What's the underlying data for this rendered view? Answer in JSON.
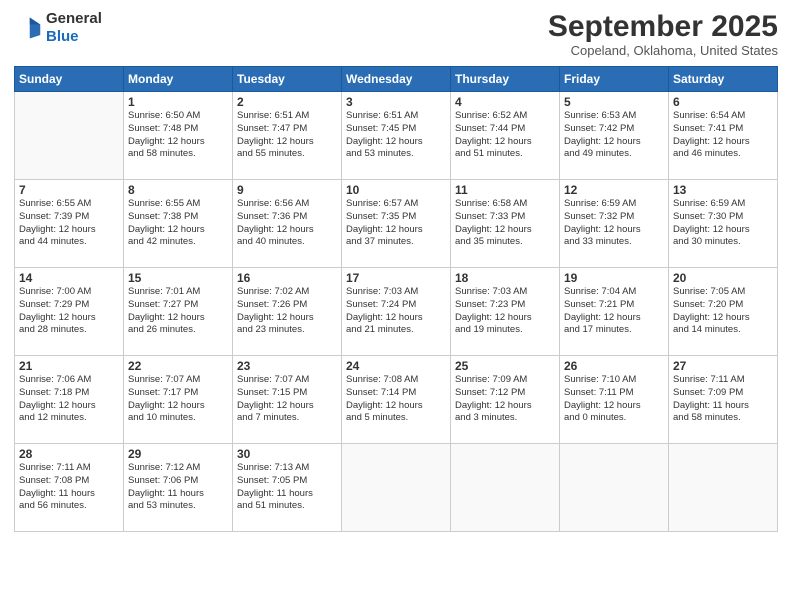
{
  "logo": {
    "line1": "General",
    "line2": "Blue"
  },
  "title": "September 2025",
  "location": "Copeland, Oklahoma, United States",
  "days_header": [
    "Sunday",
    "Monday",
    "Tuesday",
    "Wednesday",
    "Thursday",
    "Friday",
    "Saturday"
  ],
  "weeks": [
    [
      {
        "day": "",
        "info": ""
      },
      {
        "day": "1",
        "info": "Sunrise: 6:50 AM\nSunset: 7:48 PM\nDaylight: 12 hours\nand 58 minutes."
      },
      {
        "day": "2",
        "info": "Sunrise: 6:51 AM\nSunset: 7:47 PM\nDaylight: 12 hours\nand 55 minutes."
      },
      {
        "day": "3",
        "info": "Sunrise: 6:51 AM\nSunset: 7:45 PM\nDaylight: 12 hours\nand 53 minutes."
      },
      {
        "day": "4",
        "info": "Sunrise: 6:52 AM\nSunset: 7:44 PM\nDaylight: 12 hours\nand 51 minutes."
      },
      {
        "day": "5",
        "info": "Sunrise: 6:53 AM\nSunset: 7:42 PM\nDaylight: 12 hours\nand 49 minutes."
      },
      {
        "day": "6",
        "info": "Sunrise: 6:54 AM\nSunset: 7:41 PM\nDaylight: 12 hours\nand 46 minutes."
      }
    ],
    [
      {
        "day": "7",
        "info": "Sunrise: 6:55 AM\nSunset: 7:39 PM\nDaylight: 12 hours\nand 44 minutes."
      },
      {
        "day": "8",
        "info": "Sunrise: 6:55 AM\nSunset: 7:38 PM\nDaylight: 12 hours\nand 42 minutes."
      },
      {
        "day": "9",
        "info": "Sunrise: 6:56 AM\nSunset: 7:36 PM\nDaylight: 12 hours\nand 40 minutes."
      },
      {
        "day": "10",
        "info": "Sunrise: 6:57 AM\nSunset: 7:35 PM\nDaylight: 12 hours\nand 37 minutes."
      },
      {
        "day": "11",
        "info": "Sunrise: 6:58 AM\nSunset: 7:33 PM\nDaylight: 12 hours\nand 35 minutes."
      },
      {
        "day": "12",
        "info": "Sunrise: 6:59 AM\nSunset: 7:32 PM\nDaylight: 12 hours\nand 33 minutes."
      },
      {
        "day": "13",
        "info": "Sunrise: 6:59 AM\nSunset: 7:30 PM\nDaylight: 12 hours\nand 30 minutes."
      }
    ],
    [
      {
        "day": "14",
        "info": "Sunrise: 7:00 AM\nSunset: 7:29 PM\nDaylight: 12 hours\nand 28 minutes."
      },
      {
        "day": "15",
        "info": "Sunrise: 7:01 AM\nSunset: 7:27 PM\nDaylight: 12 hours\nand 26 minutes."
      },
      {
        "day": "16",
        "info": "Sunrise: 7:02 AM\nSunset: 7:26 PM\nDaylight: 12 hours\nand 23 minutes."
      },
      {
        "day": "17",
        "info": "Sunrise: 7:03 AM\nSunset: 7:24 PM\nDaylight: 12 hours\nand 21 minutes."
      },
      {
        "day": "18",
        "info": "Sunrise: 7:03 AM\nSunset: 7:23 PM\nDaylight: 12 hours\nand 19 minutes."
      },
      {
        "day": "19",
        "info": "Sunrise: 7:04 AM\nSunset: 7:21 PM\nDaylight: 12 hours\nand 17 minutes."
      },
      {
        "day": "20",
        "info": "Sunrise: 7:05 AM\nSunset: 7:20 PM\nDaylight: 12 hours\nand 14 minutes."
      }
    ],
    [
      {
        "day": "21",
        "info": "Sunrise: 7:06 AM\nSunset: 7:18 PM\nDaylight: 12 hours\nand 12 minutes."
      },
      {
        "day": "22",
        "info": "Sunrise: 7:07 AM\nSunset: 7:17 PM\nDaylight: 12 hours\nand 10 minutes."
      },
      {
        "day": "23",
        "info": "Sunrise: 7:07 AM\nSunset: 7:15 PM\nDaylight: 12 hours\nand 7 minutes."
      },
      {
        "day": "24",
        "info": "Sunrise: 7:08 AM\nSunset: 7:14 PM\nDaylight: 12 hours\nand 5 minutes."
      },
      {
        "day": "25",
        "info": "Sunrise: 7:09 AM\nSunset: 7:12 PM\nDaylight: 12 hours\nand 3 minutes."
      },
      {
        "day": "26",
        "info": "Sunrise: 7:10 AM\nSunset: 7:11 PM\nDaylight: 12 hours\nand 0 minutes."
      },
      {
        "day": "27",
        "info": "Sunrise: 7:11 AM\nSunset: 7:09 PM\nDaylight: 11 hours\nand 58 minutes."
      }
    ],
    [
      {
        "day": "28",
        "info": "Sunrise: 7:11 AM\nSunset: 7:08 PM\nDaylight: 11 hours\nand 56 minutes."
      },
      {
        "day": "29",
        "info": "Sunrise: 7:12 AM\nSunset: 7:06 PM\nDaylight: 11 hours\nand 53 minutes."
      },
      {
        "day": "30",
        "info": "Sunrise: 7:13 AM\nSunset: 7:05 PM\nDaylight: 11 hours\nand 51 minutes."
      },
      {
        "day": "",
        "info": ""
      },
      {
        "day": "",
        "info": ""
      },
      {
        "day": "",
        "info": ""
      },
      {
        "day": "",
        "info": ""
      }
    ]
  ]
}
